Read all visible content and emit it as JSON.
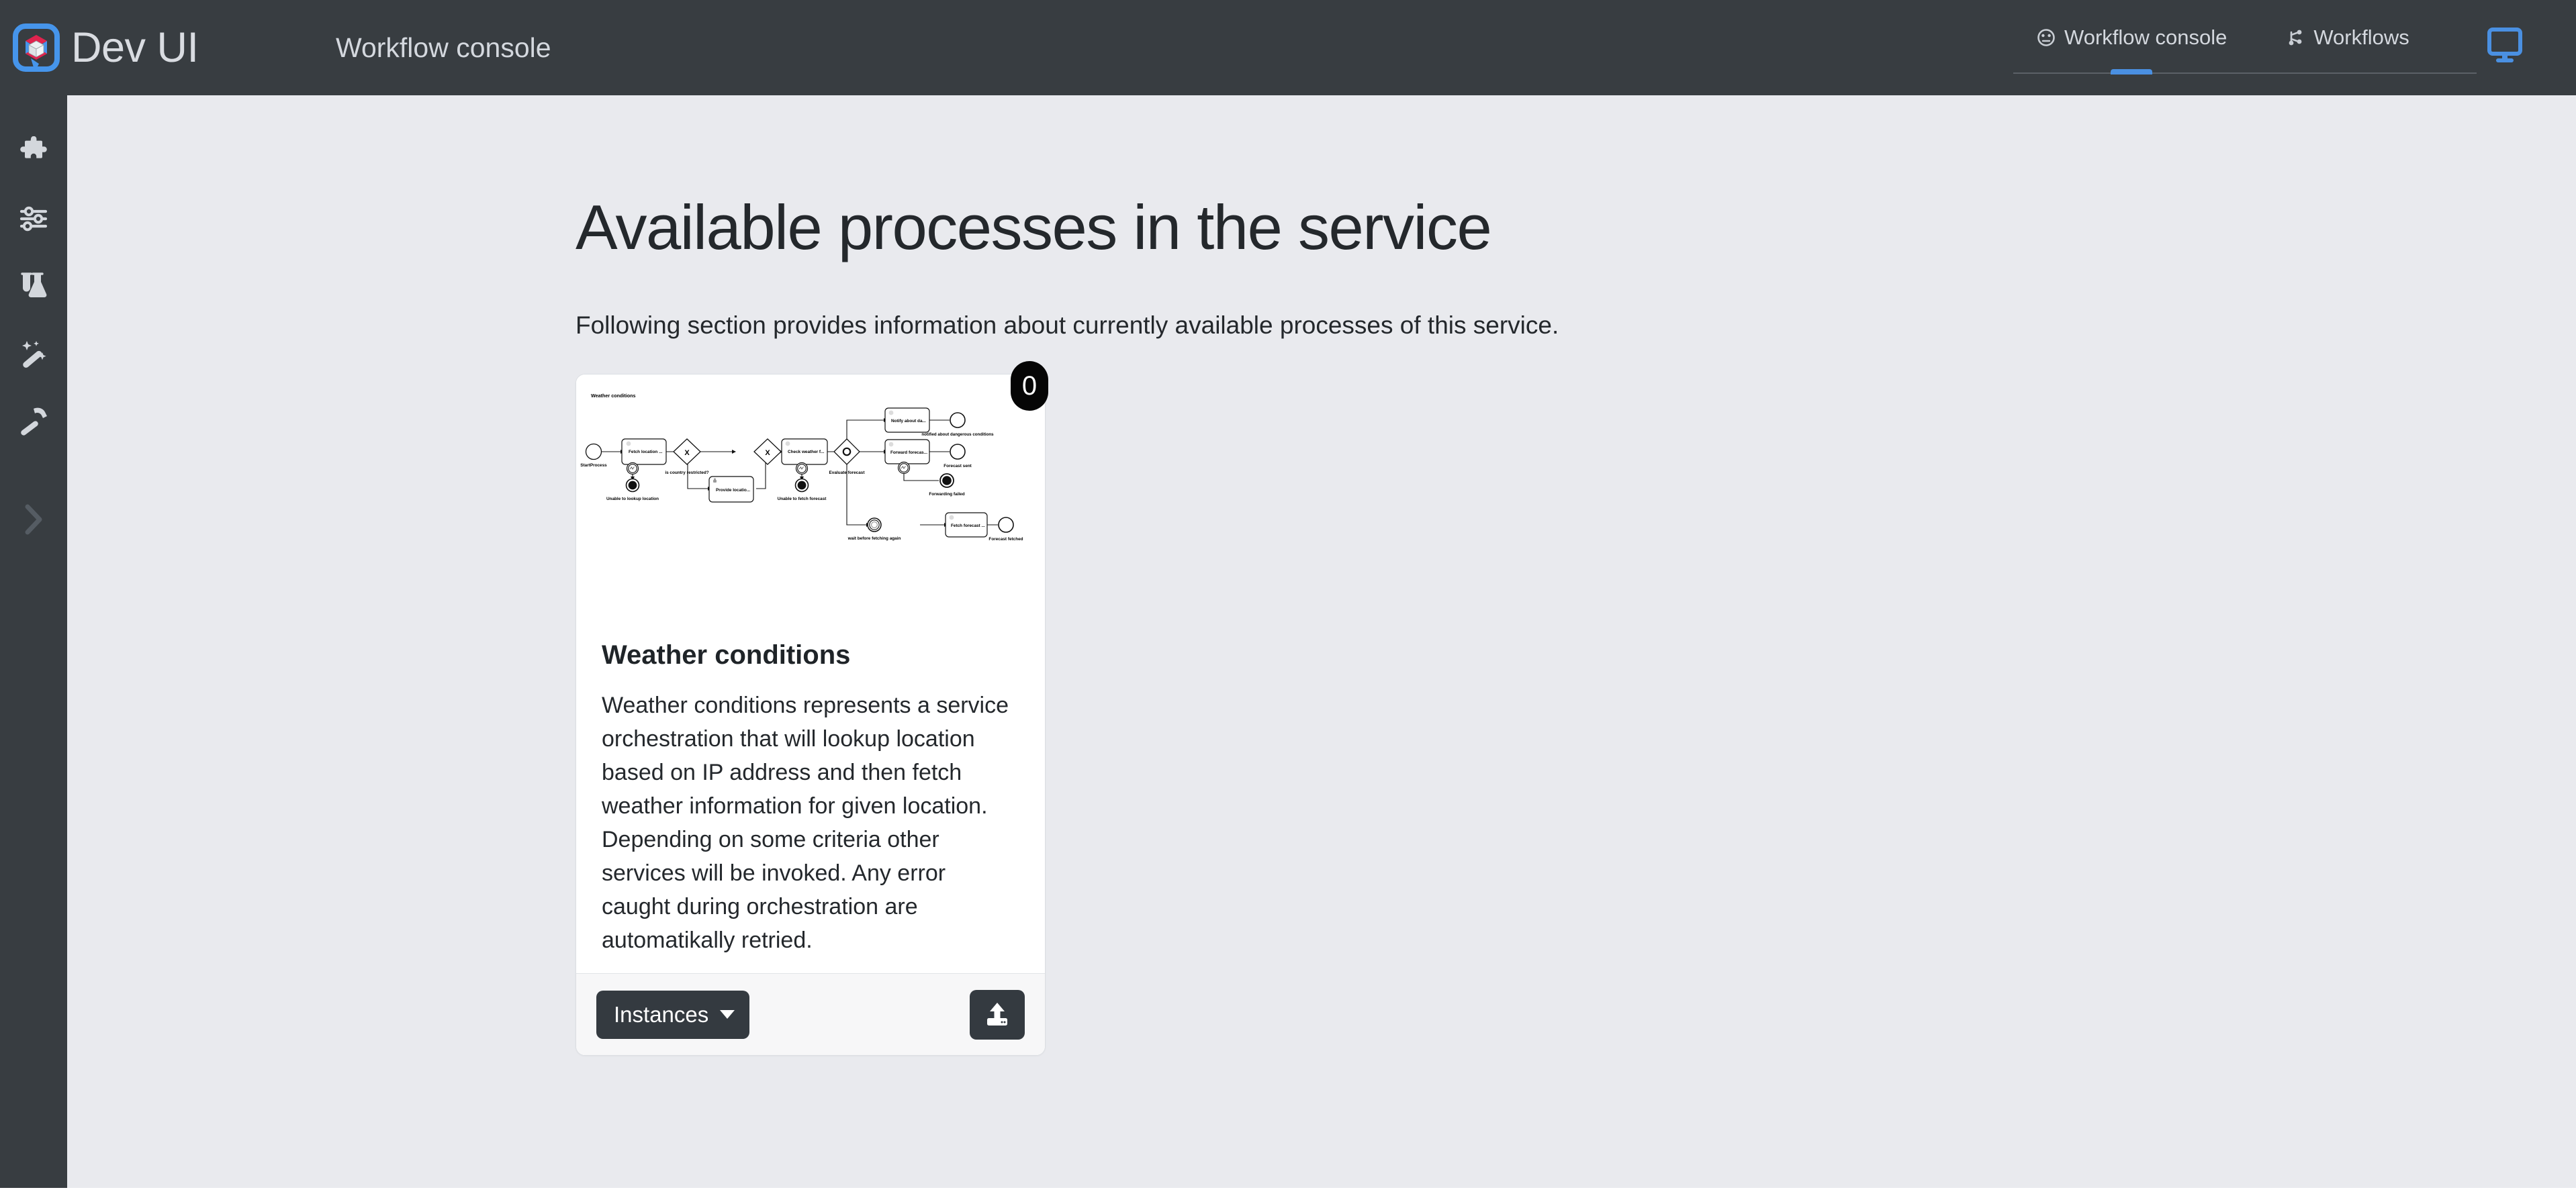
{
  "topbar": {
    "logo_icon": "quarkus-logo-icon",
    "brand_name": "Dev UI",
    "app_title": "Workflow console",
    "tabs": [
      {
        "label": "Workflow console",
        "icon": "dashboard-gauge-icon",
        "active": true
      },
      {
        "label": "Workflows",
        "icon": "sitemap-branch-icon",
        "active": false
      }
    ],
    "display_button_icon": "monitor-display-icon",
    "accent_color": "#4a90e2",
    "background_color": "#383d41"
  },
  "sidebar": {
    "background_color": "#383d41",
    "items": [
      {
        "name": "extensions",
        "icon": "puzzle-piece-icon"
      },
      {
        "name": "configuration",
        "icon": "sliders-icon"
      },
      {
        "name": "testing",
        "icon": "flask-test-tubes-icon"
      },
      {
        "name": "dev-services",
        "icon": "magic-wand-icon"
      },
      {
        "name": "build",
        "icon": "hammer-icon"
      }
    ],
    "expand_icon": "chevron-right-icon"
  },
  "main": {
    "background_color": "#e9eaee",
    "heading": "Available processes in the service",
    "subtitle": "Following section provides information about currently available processes of this service."
  },
  "card": {
    "badge_count": "0",
    "title": "Weather conditions",
    "description": "Weather conditions represents a service orchestration that will lookup location based on IP address and then fetch weather information for given location. Depending on some criteria other services will be invoked. Any error caught during orchestration are automatikally retried.",
    "footer": {
      "instances_label": "Instances",
      "instances_caret_icon": "caret-down-icon",
      "upload_icon": "upload-icon"
    },
    "diagram": {
      "type": "bpmn",
      "pool_label": "Weather conditions",
      "nodes": [
        {
          "id": "start",
          "type": "start-event",
          "label": "StartProcess"
        },
        {
          "id": "fetch-location",
          "type": "service-task",
          "label": "Fetch location ..."
        },
        {
          "id": "unable-lookup",
          "type": "end-error-event",
          "label": "Unable to lookup location"
        },
        {
          "id": "gw-restricted",
          "type": "exclusive-gateway",
          "label": "is country restricted?"
        },
        {
          "id": "provide-location",
          "type": "user-task",
          "label": "Provide locatio..."
        },
        {
          "id": "gw-join",
          "type": "exclusive-gateway",
          "label": ""
        },
        {
          "id": "check-weather",
          "type": "service-task",
          "label": "Check weather f..."
        },
        {
          "id": "unable-fetch",
          "type": "end-error-event",
          "label": "Unable to fetch forecast"
        },
        {
          "id": "evaluate-forecast",
          "type": "inclusive-gateway",
          "label": "Evaluate forecast"
        },
        {
          "id": "notify-dangerous",
          "type": "service-task",
          "label": "Notify about da..."
        },
        {
          "id": "notified-end",
          "type": "end-event",
          "label": "notified about dangerous conditions"
        },
        {
          "id": "forward-forecast",
          "type": "service-task",
          "label": "Forward forecas..."
        },
        {
          "id": "forecast-sent",
          "type": "end-event",
          "label": "Forecast sent"
        },
        {
          "id": "forwarding-failed",
          "type": "end-error-event",
          "label": "Forwarding failed"
        },
        {
          "id": "wait-timer",
          "type": "timer-event",
          "label": "wait before fetching again"
        },
        {
          "id": "fetch-forecast",
          "type": "service-task",
          "label": "Fetch forecast ..."
        },
        {
          "id": "forecast-fetched",
          "type": "end-event",
          "label": "Forecast fetched"
        }
      ]
    }
  }
}
